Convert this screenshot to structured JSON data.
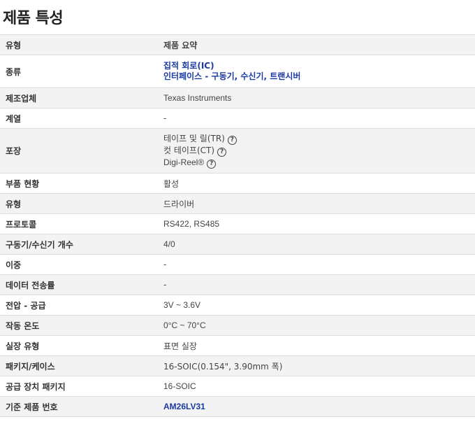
{
  "page_title": "제품 특성",
  "header": {
    "type_label": "유형",
    "summary_label": "제품 요약"
  },
  "rows": [
    {
      "label": "종류",
      "links": [
        "집적 회로(IC)",
        "인터페이스 - 구동기, 수신기, 트랜시버"
      ]
    },
    {
      "label": "제조업체",
      "value": "Texas Instruments"
    },
    {
      "label": "계열",
      "value": "-"
    },
    {
      "label": "포장",
      "packaging": [
        "테이프 및 릴(TR)",
        "컷 테이프(CT)",
        "Digi-Reel®"
      ]
    },
    {
      "label": "부품 현황",
      "value": "활성"
    },
    {
      "label": "유형",
      "value": "드라이버"
    },
    {
      "label": "프로토콜",
      "value": "RS422, RS485"
    },
    {
      "label": "구동기/수신기 개수",
      "value": "4/0"
    },
    {
      "label": "이중",
      "value": "-"
    },
    {
      "label": "데이터 전송률",
      "value": "-"
    },
    {
      "label": "전압 - 공급",
      "value": "3V ~ 3.6V"
    },
    {
      "label": "작동 온도",
      "value": "0°C ~ 70°C"
    },
    {
      "label": "실장 유형",
      "value": "표면 실장"
    },
    {
      "label": "패키지/케이스",
      "value": "16-SOIC(0.154\", 3.90mm 폭)"
    },
    {
      "label": "공급 장치 패키지",
      "value": "16-SOIC"
    },
    {
      "label": "기준 제품 번호",
      "value": "AM26LV31"
    }
  ],
  "icons": {
    "help": "question-circle-icon"
  },
  "colors": {
    "link": "#1a3aa3",
    "alt_row": "#f3f3f3",
    "border": "#dddddd"
  }
}
